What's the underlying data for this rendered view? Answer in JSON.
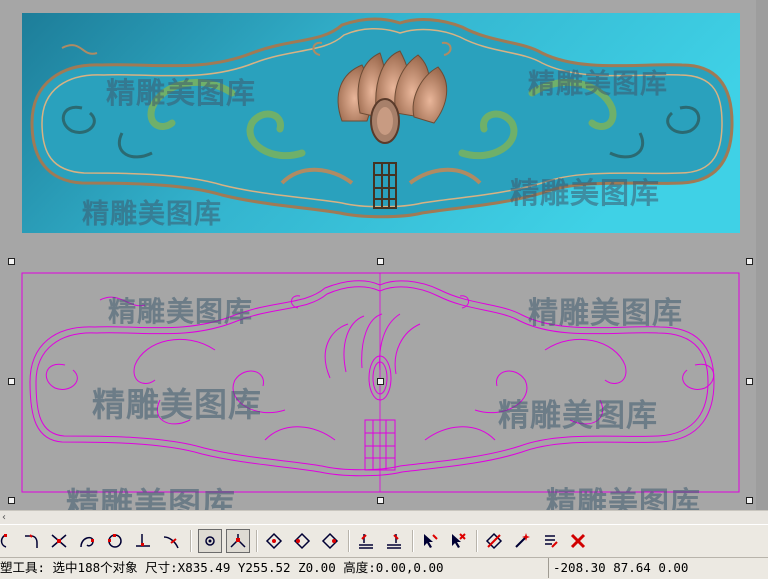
{
  "watermark": "精雕美图库",
  "status": {
    "message": "塑工具: 选中188个对象 尺寸:X835.49 Y255.52 Z0.00 高度:0.00,0.00",
    "coords": "-208.30 87.64 0.00"
  },
  "colors": {
    "relief_bg": "#2ea7c2",
    "vector_stroke": "#e000e0",
    "canvas_bg": "#a6a6a6"
  },
  "toolbar": {
    "icons": [
      "arc-tool-icon",
      "fillet-icon",
      "trim-icon",
      "curve-edit-icon",
      "target-icon",
      "perpendicular-icon",
      "extend-icon",
      "snap-point-icon",
      "angle-icon",
      "node-diamond-icon",
      "node-diamond-2-icon",
      "node-diamond-3-icon",
      "layer-stack-icon",
      "layer-stack-2-icon",
      "select-arrow-icon",
      "delete-arrow-icon",
      "transform-icon",
      "magic-icon",
      "list-edit-icon",
      "close-x-icon"
    ]
  }
}
